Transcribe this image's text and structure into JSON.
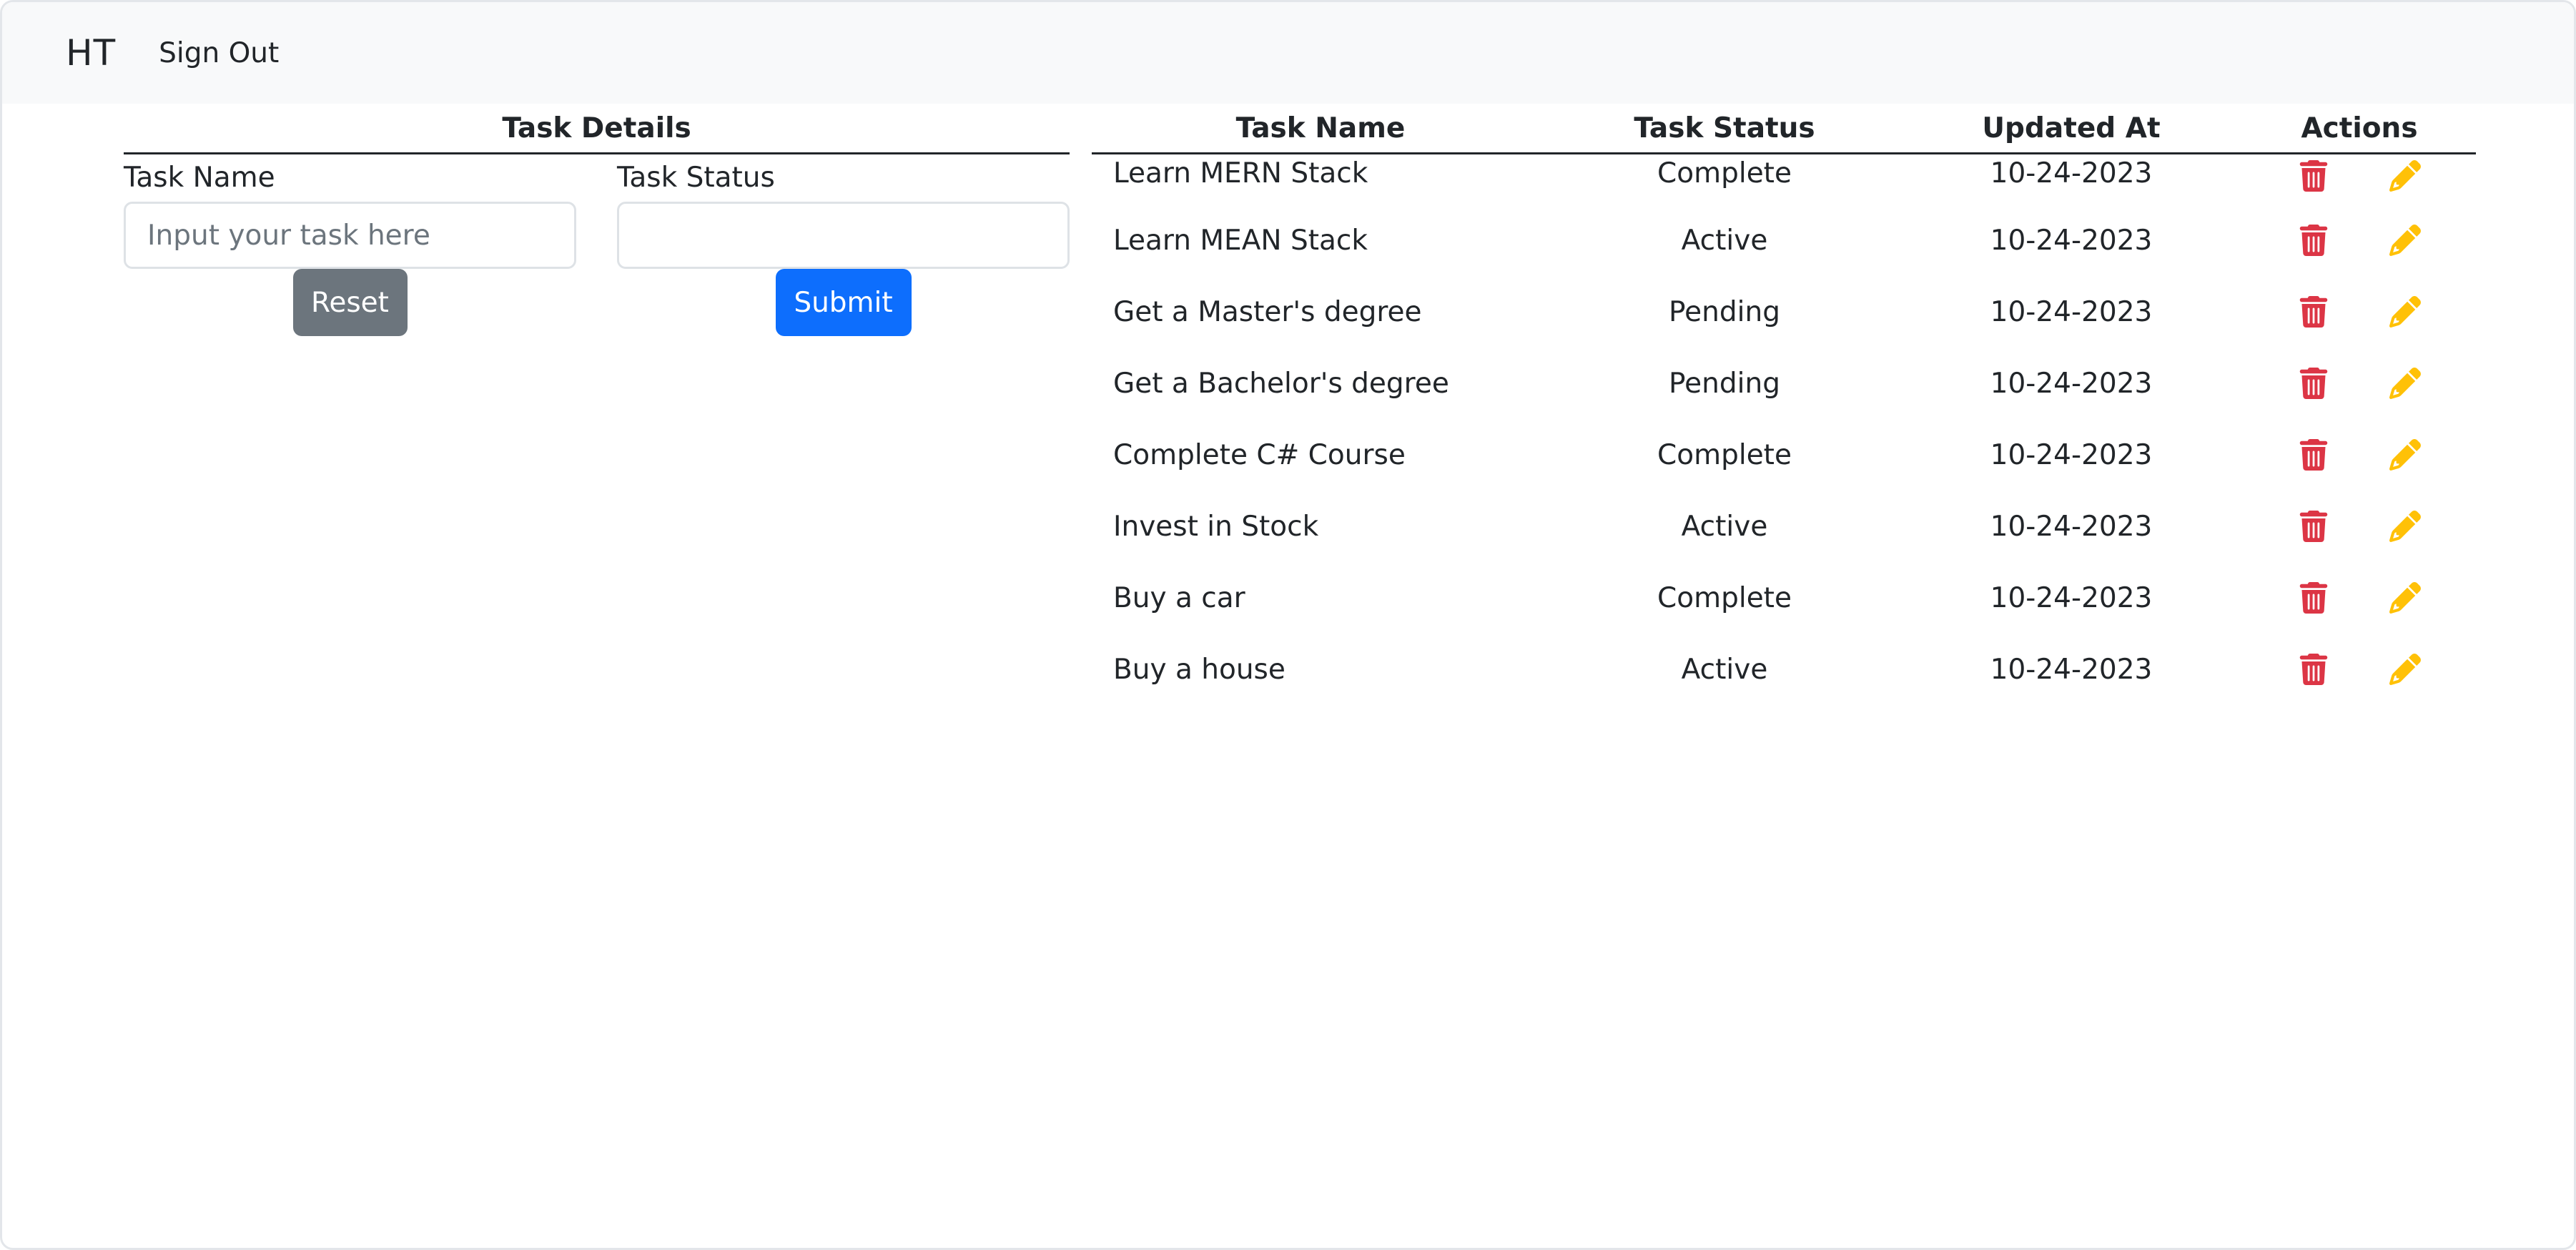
{
  "navbar": {
    "brand": "HT",
    "signout_label": "Sign Out"
  },
  "form": {
    "title": "Task Details",
    "task_name_label": "Task Name",
    "task_name_value": "",
    "task_name_placeholder": "Input your task here",
    "task_status_label": "Task Status",
    "task_status_value": "",
    "reset_label": "Reset",
    "submit_label": "Submit"
  },
  "table": {
    "headers": {
      "name": "Task Name",
      "status": "Task Status",
      "updated": "Updated At",
      "actions": "Actions"
    },
    "rows": [
      {
        "name": "Learn MERN Stack",
        "status": "Complete",
        "updated": "10-24-2023"
      },
      {
        "name": "Learn MEAN Stack",
        "status": "Active",
        "updated": "10-24-2023"
      },
      {
        "name": "Get a Master's degree",
        "status": "Pending",
        "updated": "10-24-2023"
      },
      {
        "name": "Get a Bachelor's degree",
        "status": "Pending",
        "updated": "10-24-2023"
      },
      {
        "name": "Complete C# Course",
        "status": "Complete",
        "updated": "10-24-2023"
      },
      {
        "name": "Invest in Stock",
        "status": "Active",
        "updated": "10-24-2023"
      },
      {
        "name": "Buy a car",
        "status": "Complete",
        "updated": "10-24-2023"
      },
      {
        "name": "Buy a house",
        "status": "Active",
        "updated": "10-24-2023"
      }
    ],
    "delete_icon": "trash-icon",
    "edit_icon": "pencil-icon"
  },
  "colors": {
    "navbar_bg": "#f8f9fa",
    "reset_button": "#6c757d",
    "submit_button": "#0d6efd",
    "delete_icon": "#dc3545",
    "edit_icon": "#ffc107"
  }
}
